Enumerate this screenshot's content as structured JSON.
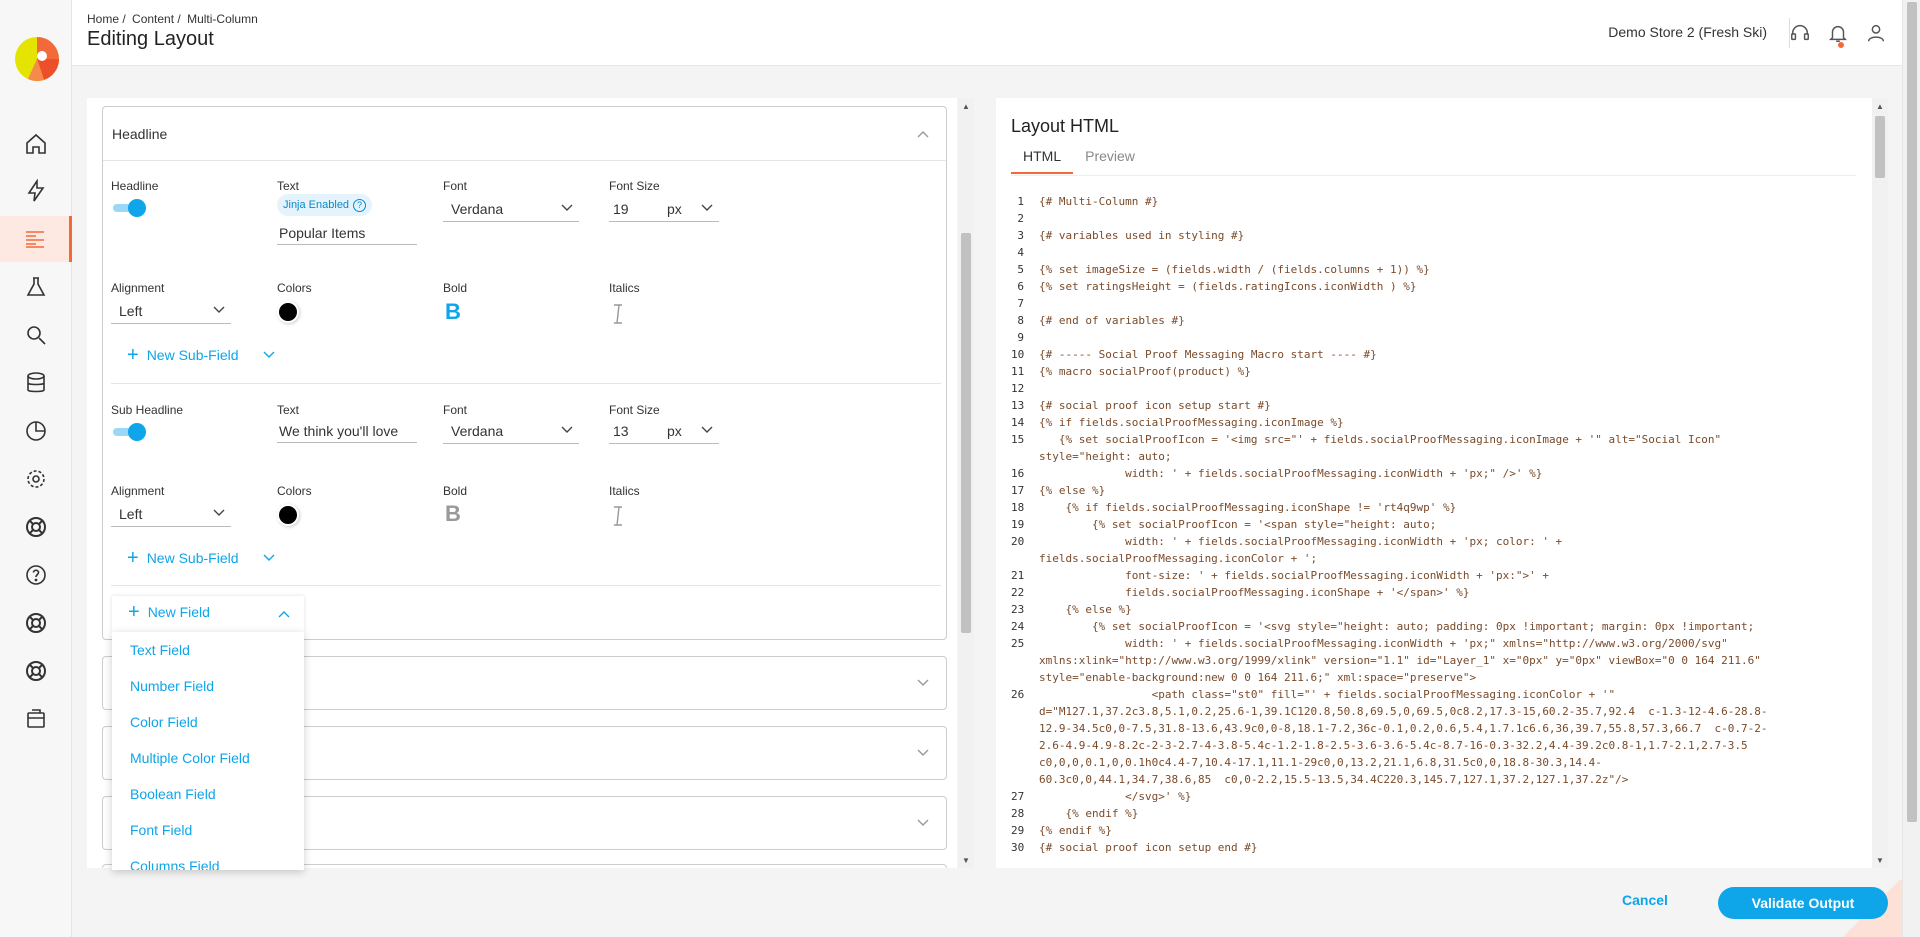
{
  "header": {
    "breadcrumb": [
      "Home /",
      "Content /",
      "Multi-Column"
    ],
    "title": "Editing Layout",
    "store": "Demo Store 2 (Fresh Ski)"
  },
  "sidebar": {
    "items": [
      "home-icon",
      "bolt-icon",
      "content-icon",
      "flask-icon",
      "search-icon",
      "database-icon",
      "chart-icon",
      "settings-icon",
      "lifebuoy-icon",
      "help-icon",
      "lifebuoy-icon",
      "lifebuoy-icon",
      "box-icon"
    ],
    "active_index": 2
  },
  "headline_section": {
    "title": "Headline",
    "headline": {
      "toggle_label": "Headline",
      "text_label": "Text",
      "jinja_badge": "Jinja Enabled",
      "text_value": "Popular Items",
      "font_label": "Font",
      "font_value": "Verdana",
      "font_size_label": "Font Size",
      "font_size_value": "19",
      "unit": "px",
      "alignment_label": "Alignment",
      "alignment_value": "Left",
      "colors_label": "Colors",
      "bold_label": "Bold",
      "italics_label": "Italics",
      "bold_glyph": "B",
      "new_subfield": "New Sub-Field"
    },
    "subheadline": {
      "toggle_label": "Sub Headline",
      "text_label": "Text",
      "text_value": "We think you'll love",
      "font_label": "Font",
      "font_value": "Verdana",
      "font_size_label": "Font Size",
      "font_size_value": "13",
      "unit": "px",
      "alignment_label": "Alignment",
      "alignment_value": "Left",
      "colors_label": "Colors",
      "bold_label": "Bold",
      "italics_label": "Italics",
      "bold_glyph": "B",
      "new_subfield": "New Sub-Field"
    },
    "new_field": "New Field"
  },
  "new_field_menu": [
    "Text Field",
    "Number Field",
    "Color Field",
    "Multiple Color Field",
    "Boolean Field",
    "Font Field",
    "Columns Field"
  ],
  "right_panel": {
    "title": "Layout HTML",
    "tabs": [
      "HTML",
      "Preview"
    ],
    "code": [
      {
        "n": "1",
        "t": "{# Multi-Column #}"
      },
      {
        "n": "2",
        "t": ""
      },
      {
        "n": "3",
        "t": "{# variables used in styling #}"
      },
      {
        "n": "4",
        "t": ""
      },
      {
        "n": "5",
        "t": "{% set imageSize = (fields.width / (fields.columns + 1)) %}"
      },
      {
        "n": "6",
        "t": "{% set ratingsHeight = (fields.ratingIcons.iconWidth ) %}"
      },
      {
        "n": "7",
        "t": ""
      },
      {
        "n": "8",
        "t": "{# end of variables #}"
      },
      {
        "n": "9",
        "t": ""
      },
      {
        "n": "10",
        "t": "{# ----- Social Proof Messaging Macro start ---- #}"
      },
      {
        "n": "11",
        "t": "{% macro socialProof(product) %}"
      },
      {
        "n": "12",
        "t": ""
      },
      {
        "n": "13",
        "t": "{# social proof icon setup start #}"
      },
      {
        "n": "14",
        "t": "{% if fields.socialProofMessaging.iconImage %}"
      },
      {
        "n": "15",
        "t": "   {% set socialProofIcon = '<img src=\"' + fields.socialProofMessaging.iconImage + '\" alt=\"Social Icon\"\nstyle=\"height: auto;"
      },
      {
        "n": "16",
        "t": "             width: ' + fields.socialProofMessaging.iconWidth + 'px;\" />' %}"
      },
      {
        "n": "17",
        "t": "{% else %}"
      },
      {
        "n": "18",
        "t": "    {% if fields.socialProofMessaging.iconShape != 'rt4q9wp' %}"
      },
      {
        "n": "19",
        "t": "        {% set socialProofIcon = '<span style=\"height: auto;"
      },
      {
        "n": "20",
        "t": "             width: ' + fields.socialProofMessaging.iconWidth + 'px; color: ' +\nfields.socialProofMessaging.iconColor + ';"
      },
      {
        "n": "21",
        "t": "             font-size: ' + fields.socialProofMessaging.iconWidth + 'px:\">' +"
      },
      {
        "n": "22",
        "t": "             fields.socialProofMessaging.iconShape + '</span>' %}"
      },
      {
        "n": "23",
        "t": "    {% else %}"
      },
      {
        "n": "24",
        "t": "        {% set socialProofIcon = '<svg style=\"height: auto; padding: 0px !important; margin: 0px !important;"
      },
      {
        "n": "25",
        "t": "             width: ' + fields.socialProofMessaging.iconWidth + 'px;\" xmlns=\"http://www.w3.org/2000/svg\"\nxmlns:xlink=\"http://www.w3.org/1999/xlink\" version=\"1.1\" id=\"Layer_1\" x=\"0px\" y=\"0px\" viewBox=\"0 0 164 211.6\"\nstyle=\"enable-background:new 0 0 164 211.6;\" xml:space=\"preserve\">"
      },
      {
        "n": "26",
        "t": "                 <path class=\"st0\" fill=\"' + fields.socialProofMessaging.iconColor + '\"\nd=\"M127.1,37.2c3.8,5.1,0.2,25.6-1,39.1C120.8,50.8,69.5,0,69.5,0c8.2,17.3-15,60.2-35.7,92.4  c-1.3-12-4.6-28.8-\n12.9-34.5c0,0-7.5,31.8-13.6,43.9c0,0-8,18.1-7.2,36c-0.1,0.2,0.6,5.4,1.7.1c6.6,36,39.7,55.8,57.3,66.7  c-0.7-2-\n2.6-4.9-4.9-8.2c-2-3-2.7-4-3.8-5.4c-1.2-1.8-2.5-3.6-3.6-5.4c-8.7-16-0.3-32.2,4.4-39.2c0.8-1,1.7-2.1,2.7-3.5\nc0,0,0,0.1,0,0.1h0c4.4-7,10.4-17.1,11.1-29c0,0,13.2,21.1,6.8,31.5c0,0,18.8-30.3,14.4-\n60.3c0,0,44.1,34.7,38.6,85  c0,0-2.2,15.5-13.5,34.4C220.3,145.7,127.1,37.2,127.1,37.2z\"/>"
      },
      {
        "n": "27",
        "t": "             </svg>' %}"
      },
      {
        "n": "28",
        "t": "    {% endif %}"
      },
      {
        "n": "29",
        "t": "{% endif %}"
      },
      {
        "n": "30",
        "t": "{# social proof icon setup end #}"
      }
    ]
  },
  "footer": {
    "cancel": "Cancel",
    "validate": "Validate Output"
  },
  "colors": {
    "accent": "#0ea5e9",
    "brand_orange": "#f26a3a"
  }
}
